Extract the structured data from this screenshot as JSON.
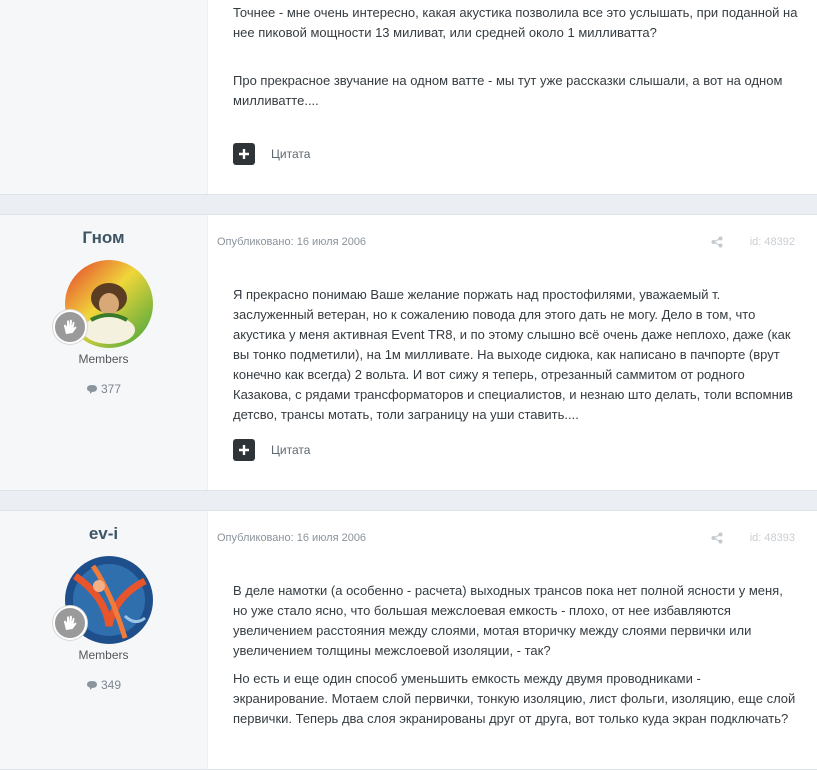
{
  "posts": [
    {
      "paragraphs": [
        "Точнее - мне очень интересно, какая акустика позволила все это услышать, при поданной на нее пиковой мощности 13 миливат, или средней около 1 милливатта?",
        "Про прекрасное звучание на одном ватте - мы тут уже рассказки слышали, а вот на одном милливатте...."
      ],
      "quote_label": "Цитата"
    },
    {
      "author": "Гном",
      "group": "Members",
      "post_count": "377",
      "published": "Опубликовано: 16 июля 2006",
      "post_id": "id: 48392",
      "paragraphs": [
        "Я прекрасно понимаю Ваше желание поржать над простофилями, уважаемый т. заслуженный ветеран, но к сожалению повода для этого дать не могу. Дело в том, что акустика у меня активная Event TR8, и по этому слышно всё очень даже неплохо, даже (как вы тонко подметили), на 1м милливате. На выходе сидюка, как написано в пачпорте (врут конечно как всегда) 2 вольта. И вот сижу я теперь, отрезанный саммитом от родного Казакова, с рядами трансформаторов и специалистов, и незнаю што делать, толи вспомнив детсво, трансы мотать, толи заграницу на уши ставить...."
      ],
      "quote_label": "Цитата"
    },
    {
      "author": "ev-i",
      "group": "Members",
      "post_count": "349",
      "published": "Опубликовано: 16 июля 2006",
      "post_id": "id: 48393",
      "paragraphs": [
        "В деле намотки (а особенно - расчета) выходных трансов пока нет полной ясности у меня, но уже стало ясно, что большая межслоевая емкость - плохо, от нее избавляются увеличением расстояния между слоями, мотая вторичку между слоями первички или увеличением толщины межслоевой изоляции, - так?",
        "Но есть и еще один способ уменьшить емкость между двумя проводниками - экранирование. Мотаем слой первички, тонкую изоляцию, лист фольги, изоляцию, еще слой первички. Теперь два слоя экранированы друг от друга, вот только куда экран подключать?"
      ]
    }
  ]
}
